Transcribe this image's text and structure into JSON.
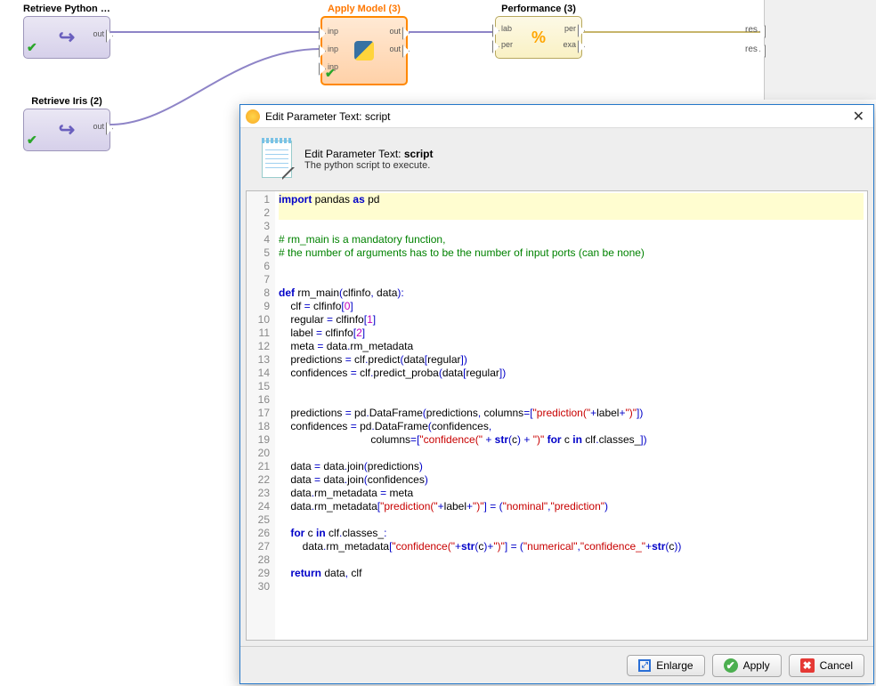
{
  "nodes": {
    "retrieve_gbt": {
      "title": "Retrieve Python GBT...",
      "out_label": "out"
    },
    "retrieve_iris": {
      "title": "Retrieve Iris (2)",
      "out_label": "out"
    },
    "apply_model": {
      "title": "Apply Model (3)",
      "inp": "inp",
      "out": "out"
    },
    "performance": {
      "title": "Performance (3)",
      "lab": "lab",
      "per": "per",
      "exa": "exa"
    }
  },
  "sink": {
    "res1": "res",
    "res2": "res"
  },
  "dialog": {
    "window_title": "Edit Parameter Text: script",
    "header_title_prefix": "Edit Parameter Text: ",
    "header_title_param": "script",
    "header_sub": "The python script to execute.",
    "buttons": {
      "enlarge": "Enlarge",
      "apply": "Apply",
      "cancel": "Cancel"
    },
    "code_lines": [
      {
        "n": 1,
        "hl": true,
        "seg": [
          [
            "kw",
            "import"
          ],
          [
            "",
            " pandas "
          ],
          [
            "kw",
            "as"
          ],
          [
            "",
            " pd"
          ]
        ]
      },
      {
        "n": 2,
        "hl": true,
        "seg": [
          [
            "",
            ""
          ]
        ]
      },
      {
        "n": 3,
        "seg": [
          [
            "",
            ""
          ]
        ]
      },
      {
        "n": 4,
        "seg": [
          [
            "cm",
            "# rm_main is a mandatory function,"
          ]
        ]
      },
      {
        "n": 5,
        "seg": [
          [
            "cm",
            "# the number of arguments has to be the number of input ports (can be none)"
          ]
        ]
      },
      {
        "n": 6,
        "seg": [
          [
            "",
            ""
          ]
        ]
      },
      {
        "n": 7,
        "seg": [
          [
            "",
            ""
          ]
        ]
      },
      {
        "n": 8,
        "seg": [
          [
            "kw",
            "def"
          ],
          [
            "",
            " rm_main"
          ],
          [
            "op",
            "("
          ],
          [
            "",
            "clfinfo"
          ],
          [
            "op",
            ","
          ],
          [
            "",
            " data"
          ],
          [
            "op",
            ")"
          ],
          [
            "op",
            ":"
          ]
        ]
      },
      {
        "n": 9,
        "seg": [
          [
            "",
            "    clf "
          ],
          [
            "op",
            "="
          ],
          [
            "",
            " clfinfo"
          ],
          [
            "op",
            "["
          ],
          [
            "nm",
            "0"
          ],
          [
            "op",
            "]"
          ]
        ]
      },
      {
        "n": 10,
        "seg": [
          [
            "",
            "    regular "
          ],
          [
            "op",
            "="
          ],
          [
            "",
            " clfinfo"
          ],
          [
            "op",
            "["
          ],
          [
            "nm",
            "1"
          ],
          [
            "op",
            "]"
          ]
        ]
      },
      {
        "n": 11,
        "seg": [
          [
            "",
            "    label "
          ],
          [
            "op",
            "="
          ],
          [
            "",
            " clfinfo"
          ],
          [
            "op",
            "["
          ],
          [
            "nm",
            "2"
          ],
          [
            "op",
            "]"
          ]
        ]
      },
      {
        "n": 12,
        "seg": [
          [
            "",
            "    meta "
          ],
          [
            "op",
            "="
          ],
          [
            "",
            " data"
          ],
          [
            "op",
            "."
          ],
          [
            "",
            "rm_metadata"
          ]
        ]
      },
      {
        "n": 13,
        "seg": [
          [
            "",
            "    predictions "
          ],
          [
            "op",
            "="
          ],
          [
            "",
            " clf"
          ],
          [
            "op",
            "."
          ],
          [
            "",
            "predict"
          ],
          [
            "op",
            "("
          ],
          [
            "",
            "data"
          ],
          [
            "op",
            "["
          ],
          [
            "",
            "regular"
          ],
          [
            "op",
            "]"
          ],
          [
            "op",
            ")"
          ]
        ]
      },
      {
        "n": 14,
        "seg": [
          [
            "",
            "    confidences "
          ],
          [
            "op",
            "="
          ],
          [
            "",
            " clf"
          ],
          [
            "op",
            "."
          ],
          [
            "",
            "predict_proba"
          ],
          [
            "op",
            "("
          ],
          [
            "",
            "data"
          ],
          [
            "op",
            "["
          ],
          [
            "",
            "regular"
          ],
          [
            "op",
            "]"
          ],
          [
            "op",
            ")"
          ]
        ]
      },
      {
        "n": 15,
        "seg": [
          [
            "",
            ""
          ]
        ]
      },
      {
        "n": 16,
        "seg": [
          [
            "",
            ""
          ]
        ]
      },
      {
        "n": 17,
        "seg": [
          [
            "",
            "    predictions "
          ],
          [
            "op",
            "="
          ],
          [
            "",
            " pd"
          ],
          [
            "op",
            "."
          ],
          [
            "",
            "DataFrame"
          ],
          [
            "op",
            "("
          ],
          [
            "",
            "predictions"
          ],
          [
            "op",
            ","
          ],
          [
            "",
            " columns"
          ],
          [
            "op",
            "="
          ],
          [
            "op",
            "["
          ],
          [
            "st",
            "\"prediction(\""
          ],
          [
            "op",
            "+"
          ],
          [
            "",
            "label"
          ],
          [
            "op",
            "+"
          ],
          [
            "st",
            "\")\""
          ],
          [
            "op",
            "]"
          ],
          [
            "op",
            ")"
          ]
        ]
      },
      {
        "n": 18,
        "seg": [
          [
            "",
            "    confidences "
          ],
          [
            "op",
            "="
          ],
          [
            "",
            " pd"
          ],
          [
            "op",
            "."
          ],
          [
            "",
            "DataFrame"
          ],
          [
            "op",
            "("
          ],
          [
            "",
            "confidences"
          ],
          [
            "op",
            ","
          ]
        ]
      },
      {
        "n": 19,
        "seg": [
          [
            "",
            "                               columns"
          ],
          [
            "op",
            "="
          ],
          [
            "op",
            "["
          ],
          [
            "st",
            "\"confidence(\""
          ],
          [
            "",
            " "
          ],
          [
            "op",
            "+"
          ],
          [
            "",
            " "
          ],
          [
            "kw",
            "str"
          ],
          [
            "op",
            "("
          ],
          [
            "",
            "c"
          ],
          [
            "op",
            ")"
          ],
          [
            "",
            " "
          ],
          [
            "op",
            "+"
          ],
          [
            "",
            " "
          ],
          [
            "st",
            "\")\""
          ],
          [
            "",
            " "
          ],
          [
            "kw",
            "for"
          ],
          [
            "",
            " c "
          ],
          [
            "kw",
            "in"
          ],
          [
            "",
            " clf"
          ],
          [
            "op",
            "."
          ],
          [
            "",
            "classes_"
          ],
          [
            "op",
            "]"
          ],
          [
            "op",
            ")"
          ]
        ]
      },
      {
        "n": 20,
        "seg": [
          [
            "",
            ""
          ]
        ]
      },
      {
        "n": 21,
        "seg": [
          [
            "",
            "    data "
          ],
          [
            "op",
            "="
          ],
          [
            "",
            " data"
          ],
          [
            "op",
            "."
          ],
          [
            "",
            "join"
          ],
          [
            "op",
            "("
          ],
          [
            "",
            "predictions"
          ],
          [
            "op",
            ")"
          ]
        ]
      },
      {
        "n": 22,
        "seg": [
          [
            "",
            "    data "
          ],
          [
            "op",
            "="
          ],
          [
            "",
            " data"
          ],
          [
            "op",
            "."
          ],
          [
            "",
            "join"
          ],
          [
            "op",
            "("
          ],
          [
            "",
            "confidences"
          ],
          [
            "op",
            ")"
          ]
        ]
      },
      {
        "n": 23,
        "seg": [
          [
            "",
            "    data"
          ],
          [
            "op",
            "."
          ],
          [
            "",
            "rm_metadata "
          ],
          [
            "op",
            "="
          ],
          [
            "",
            " meta"
          ]
        ]
      },
      {
        "n": 24,
        "seg": [
          [
            "",
            "    data"
          ],
          [
            "op",
            "."
          ],
          [
            "",
            "rm_metadata"
          ],
          [
            "op",
            "["
          ],
          [
            "st",
            "\"prediction(\""
          ],
          [
            "op",
            "+"
          ],
          [
            "",
            "label"
          ],
          [
            "op",
            "+"
          ],
          [
            "st",
            "\")\""
          ],
          [
            "op",
            "]"
          ],
          [
            "",
            " "
          ],
          [
            "op",
            "="
          ],
          [
            "",
            " "
          ],
          [
            "op",
            "("
          ],
          [
            "st",
            "\"nominal\""
          ],
          [
            "op",
            ","
          ],
          [
            "st",
            "\"prediction\""
          ],
          [
            "op",
            ")"
          ]
        ]
      },
      {
        "n": 25,
        "seg": [
          [
            "",
            ""
          ]
        ]
      },
      {
        "n": 26,
        "seg": [
          [
            "",
            "    "
          ],
          [
            "kw",
            "for"
          ],
          [
            "",
            " c "
          ],
          [
            "kw",
            "in"
          ],
          [
            "",
            " clf"
          ],
          [
            "op",
            "."
          ],
          [
            "",
            "classes_"
          ],
          [
            "op",
            ":"
          ]
        ]
      },
      {
        "n": 27,
        "seg": [
          [
            "",
            "        data"
          ],
          [
            "op",
            "."
          ],
          [
            "",
            "rm_metadata"
          ],
          [
            "op",
            "["
          ],
          [
            "st",
            "\"confidence(\""
          ],
          [
            "op",
            "+"
          ],
          [
            "kw",
            "str"
          ],
          [
            "op",
            "("
          ],
          [
            "",
            "c"
          ],
          [
            "op",
            ")"
          ],
          [
            "op",
            "+"
          ],
          [
            "st",
            "\")\""
          ],
          [
            "op",
            "]"
          ],
          [
            "",
            " "
          ],
          [
            "op",
            "="
          ],
          [
            "",
            " "
          ],
          [
            "op",
            "("
          ],
          [
            "st",
            "\"numerical\""
          ],
          [
            "op",
            ","
          ],
          [
            "st",
            "\"confidence_\""
          ],
          [
            "op",
            "+"
          ],
          [
            "kw",
            "str"
          ],
          [
            "op",
            "("
          ],
          [
            "",
            "c"
          ],
          [
            "op",
            ")"
          ],
          [
            "op",
            ")"
          ]
        ]
      },
      {
        "n": 28,
        "seg": [
          [
            "",
            ""
          ]
        ]
      },
      {
        "n": 29,
        "seg": [
          [
            "",
            "    "
          ],
          [
            "kw",
            "return"
          ],
          [
            "",
            " data"
          ],
          [
            "op",
            ","
          ],
          [
            "",
            " clf"
          ]
        ]
      },
      {
        "n": 30,
        "seg": [
          [
            "",
            ""
          ]
        ]
      }
    ]
  }
}
